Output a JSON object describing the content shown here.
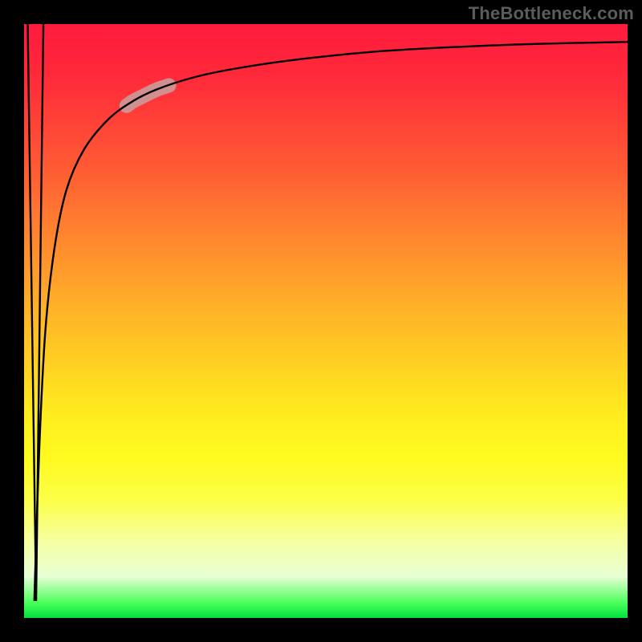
{
  "attribution": "TheBottleneck.com",
  "colors": {
    "frame": "#000000",
    "curve": "#000000",
    "highlight": "#d09090",
    "attribution_text": "#5c5c5c"
  },
  "chart_data": {
    "type": "line",
    "title": "",
    "xlabel": "",
    "ylabel": "",
    "xlim": [
      0,
      100
    ],
    "ylim": [
      0,
      100
    ],
    "grid": false,
    "legend": false,
    "gradient_background": "red-yellow-green (top to bottom)",
    "series": [
      {
        "name": "v-shaped-dip",
        "description": "near-vertical down then up near left edge",
        "x": [
          0.6,
          2.0,
          3.2
        ],
        "y": [
          100,
          3,
          100
        ]
      },
      {
        "name": "saturation-curve",
        "description": "rises sharply from near origin then flattens toward top",
        "x": [
          1.7,
          2.5,
          3.5,
          5,
          7,
          10,
          14,
          18,
          22,
          28,
          35,
          45,
          60,
          80,
          100
        ],
        "y": [
          3,
          28,
          48,
          62,
          72,
          79,
          84,
          87,
          89,
          91,
          92.5,
          94,
          95.5,
          96.5,
          97
        ]
      }
    ],
    "highlight": {
      "on_series": "saturation-curve",
      "x_range": [
        17,
        24
      ],
      "note": "short thick pale segment along the rising curve"
    }
  }
}
